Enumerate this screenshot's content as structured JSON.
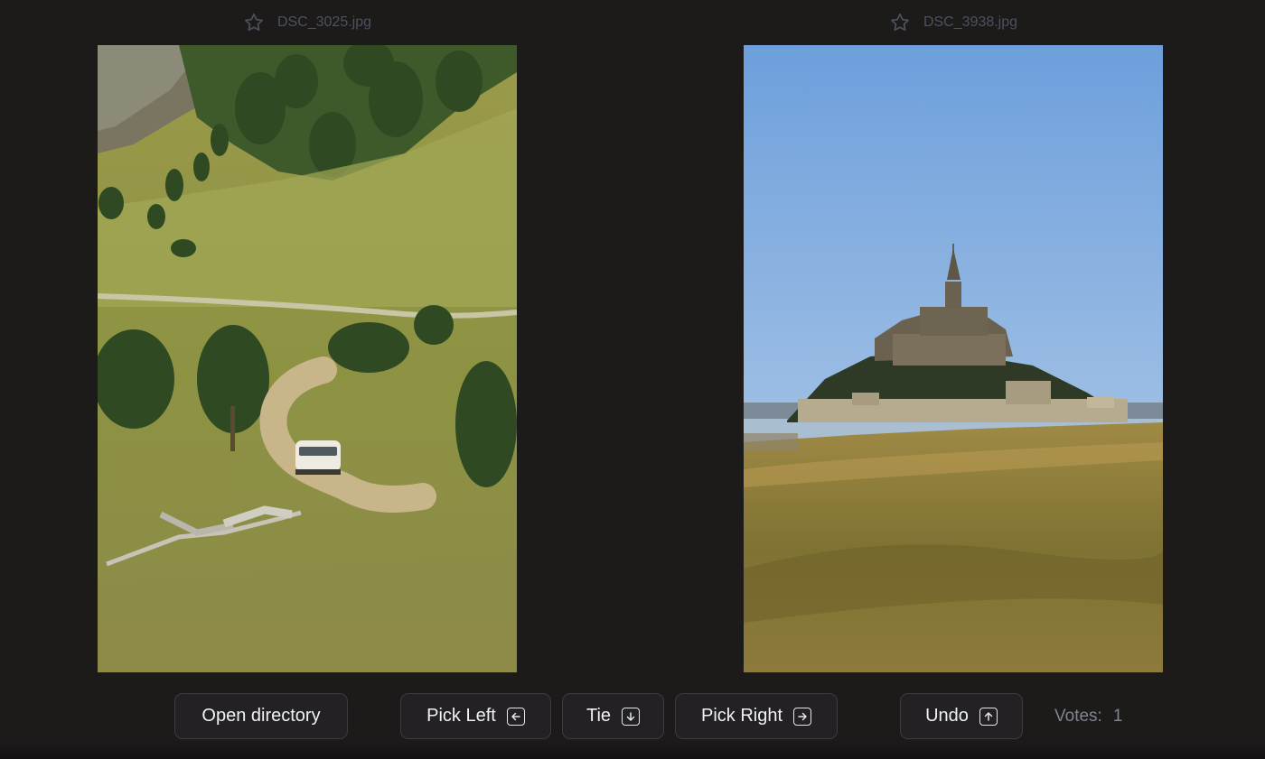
{
  "left_image": {
    "filename": "DSC_3025.jpg",
    "icon": "star-outline-icon",
    "description": "alpine hillside with a white van on a dirt road"
  },
  "right_image": {
    "filename": "DSC_3938.jpg",
    "icon": "star-outline-icon",
    "description": "Mont Saint-Michel island abbey behind salt-marsh grass"
  },
  "toolbar": {
    "open_directory_label": "Open directory",
    "pick_left_label": "Pick Left",
    "pick_left_key_icon": "arrow-left-key-icon",
    "tie_label": "Tie",
    "tie_key_icon": "arrow-down-key-icon",
    "pick_right_label": "Pick Right",
    "pick_right_key_icon": "arrow-right-key-icon",
    "undo_label": "Undo",
    "undo_key_icon": "arrow-up-key-icon",
    "votes_label": "Votes:",
    "votes_count": "1"
  },
  "colors": {
    "background": "#1d1a1a",
    "filename_text": "#4c5160",
    "button_bg": "#232124",
    "button_border": "#3b3b40",
    "button_text": "#f1f1f3",
    "votes_text": "#7f8491"
  }
}
